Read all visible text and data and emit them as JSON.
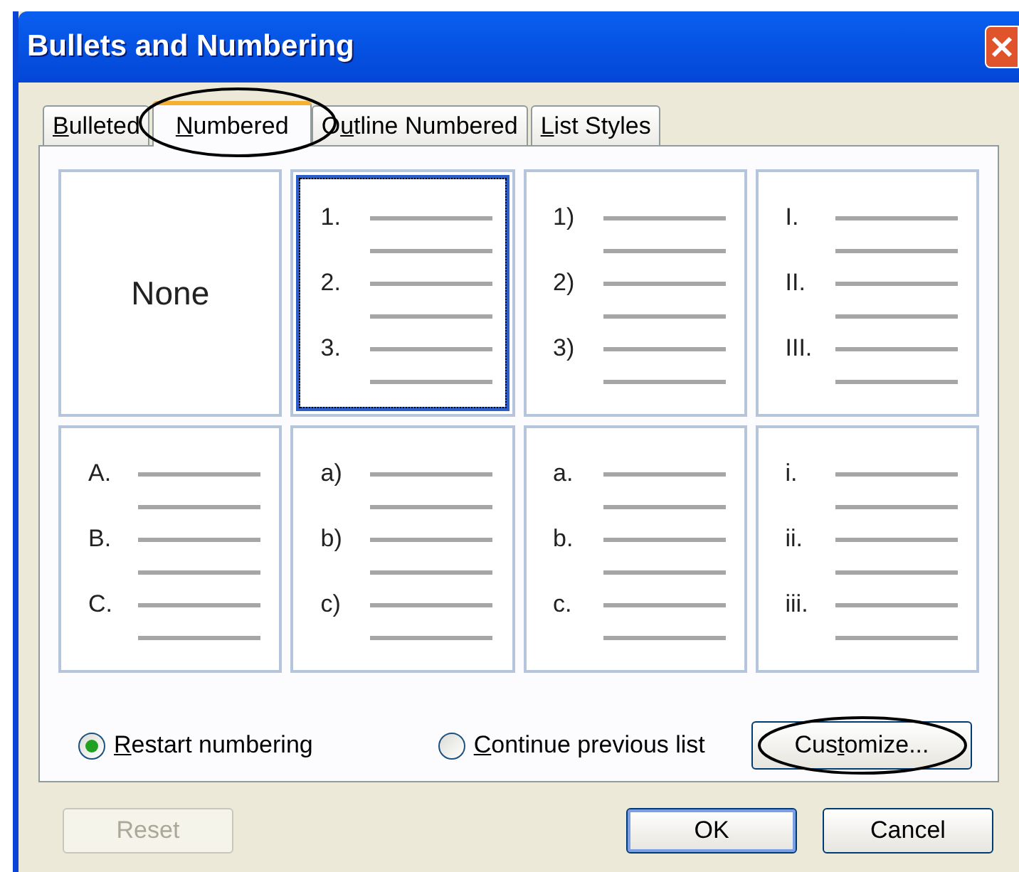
{
  "window": {
    "title": "Bullets and Numbering"
  },
  "tabs": [
    {
      "label": {
        "key": "B",
        "after": "ulleted"
      },
      "selected": false
    },
    {
      "label": {
        "key": "N",
        "after": "umbered"
      },
      "selected": true,
      "circled": true
    },
    {
      "label": {
        "before": "O",
        "key": "u",
        "after": "tline Numbered"
      },
      "selected": false
    },
    {
      "label": {
        "key": "L",
        "after": "ist Styles"
      },
      "selected": false
    }
  ],
  "styles": [
    {
      "kind": "none",
      "text": "None",
      "selected": false
    },
    {
      "kind": "list",
      "markers": [
        "1.",
        "2.",
        "3."
      ],
      "selected": true
    },
    {
      "kind": "list",
      "markers": [
        "1)",
        "2)",
        "3)"
      ],
      "selected": false
    },
    {
      "kind": "list",
      "markers": [
        "I.",
        "II.",
        "III."
      ],
      "selected": false
    },
    {
      "kind": "list",
      "markers": [
        "A.",
        "B.",
        "C."
      ],
      "selected": false
    },
    {
      "kind": "list",
      "markers": [
        "a)",
        "b)",
        "c)"
      ],
      "selected": false
    },
    {
      "kind": "list",
      "markers": [
        "a.",
        "b.",
        "c."
      ],
      "selected": false
    },
    {
      "kind": "list",
      "markers": [
        "i.",
        "ii.",
        "iii."
      ],
      "selected": false
    }
  ],
  "numbering": [
    {
      "label": {
        "key": "R",
        "after": "estart numbering"
      },
      "selected": true
    },
    {
      "label": {
        "key": "C",
        "after": "ontinue previous list"
      },
      "selected": false
    }
  ],
  "customize_button": {
    "label": {
      "before": "Cus",
      "key": "t",
      "after": "omize..."
    },
    "circled": true
  },
  "buttons": [
    {
      "label": "Reset",
      "disabled": true,
      "default": false
    },
    {
      "label": "OK",
      "disabled": false,
      "default": true
    },
    {
      "label": "Cancel",
      "disabled": false,
      "default": false
    }
  ]
}
